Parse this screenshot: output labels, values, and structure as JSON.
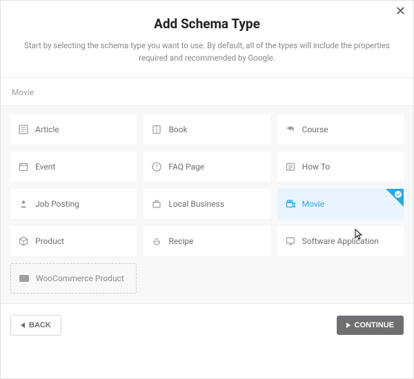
{
  "header": {
    "title": "Add Schema Type",
    "subtitle": "Start by selecting the schema type you want to use. By default, all of the types will include the properties required and recommended by Google."
  },
  "search": {
    "value": "Movie"
  },
  "cards": [
    {
      "label": "Article",
      "icon": "article-icon",
      "selected": false,
      "dashed": false
    },
    {
      "label": "Book",
      "icon": "book-icon",
      "selected": false,
      "dashed": false
    },
    {
      "label": "Course",
      "icon": "course-icon",
      "selected": false,
      "dashed": false
    },
    {
      "label": "Event",
      "icon": "event-icon",
      "selected": false,
      "dashed": false
    },
    {
      "label": "FAQ Page",
      "icon": "faq-icon",
      "selected": false,
      "dashed": false
    },
    {
      "label": "How To",
      "icon": "howto-icon",
      "selected": false,
      "dashed": false
    },
    {
      "label": "Job Posting",
      "icon": "job-icon",
      "selected": false,
      "dashed": false
    },
    {
      "label": "Local Business",
      "icon": "business-icon",
      "selected": false,
      "dashed": false
    },
    {
      "label": "Movie",
      "icon": "movie-icon",
      "selected": true,
      "dashed": false
    },
    {
      "label": "Product",
      "icon": "product-icon",
      "selected": false,
      "dashed": false
    },
    {
      "label": "Recipe",
      "icon": "recipe-icon",
      "selected": false,
      "dashed": false
    },
    {
      "label": "Software Application",
      "icon": "software-icon",
      "selected": false,
      "dashed": false
    },
    {
      "label": "WooCommerce Product",
      "icon": "woo-icon",
      "selected": false,
      "dashed": true
    }
  ],
  "footer": {
    "back_label": "BACK",
    "continue_label": "CONTINUE"
  },
  "colors": {
    "accent": "#29abe2",
    "selected_bg": "#e7f5fe",
    "card_bg": "#ffffff",
    "page_bg": "#f7f8f9",
    "muted": "#9aa0a6"
  }
}
